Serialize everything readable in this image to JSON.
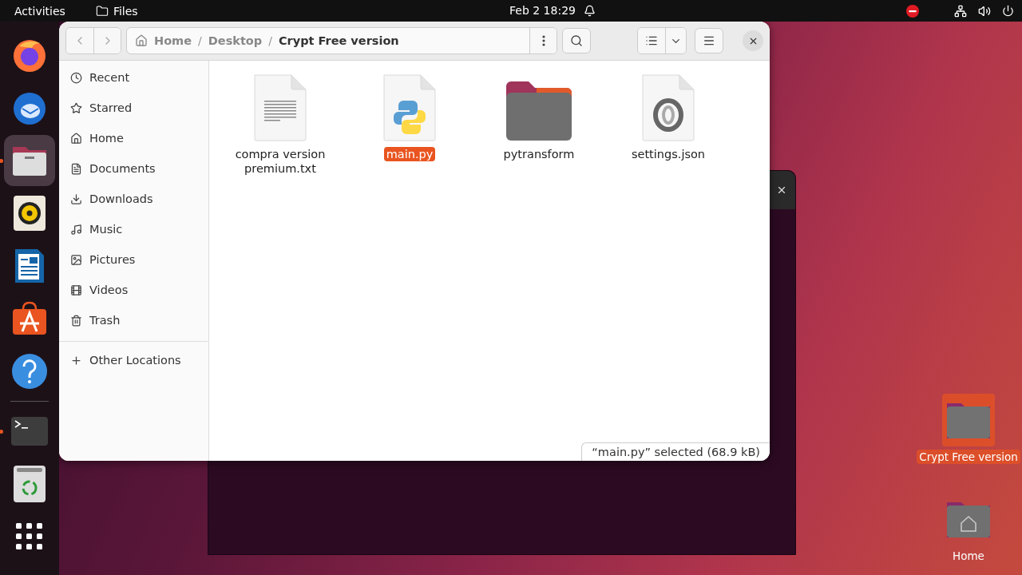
{
  "top_bar": {
    "activities": "Activities",
    "app_name": "Files",
    "datetime": "Feb 2  18:29"
  },
  "dock": {
    "items": [
      {
        "kind": "firefox",
        "running": false,
        "selected": false
      },
      {
        "kind": "thunderbird",
        "running": false,
        "selected": false
      },
      {
        "kind": "files",
        "running": true,
        "selected": true
      },
      {
        "kind": "rhythmbox",
        "running": false,
        "selected": false
      },
      {
        "kind": "writer",
        "running": false,
        "selected": false
      },
      {
        "kind": "software",
        "running": false,
        "selected": false
      },
      {
        "kind": "help",
        "running": false,
        "selected": false
      }
    ],
    "lower_items": [
      {
        "kind": "terminal",
        "running": true,
        "selected": false
      },
      {
        "kind": "trash",
        "running": false,
        "selected": false
      },
      {
        "kind": "apps",
        "running": false,
        "selected": false
      }
    ]
  },
  "window": {
    "breadcrumb": [
      {
        "label": "Home",
        "current": false
      },
      {
        "label": "Desktop",
        "current": false,
        "separator": "/"
      },
      {
        "label": "Crypt Free version",
        "current": true,
        "separator": "/"
      }
    ],
    "sidebar": {
      "items": [
        {
          "label": "Recent",
          "kind": "recent"
        },
        {
          "label": "Starred",
          "kind": "starred"
        },
        {
          "label": "Home",
          "kind": "home"
        },
        {
          "label": "Documents",
          "kind": "documents"
        },
        {
          "label": "Downloads",
          "kind": "downloads"
        },
        {
          "label": "Music",
          "kind": "music"
        },
        {
          "label": "Pictures",
          "kind": "pictures"
        },
        {
          "label": "Videos",
          "kind": "videos"
        },
        {
          "label": "Trash",
          "kind": "trash"
        }
      ],
      "other_locations": "Other Locations"
    },
    "files": [
      {
        "name": "compra version premium.txt",
        "kind": "text",
        "selected": false
      },
      {
        "name": "main.py",
        "kind": "python",
        "selected": true
      },
      {
        "name": "pytransform",
        "kind": "folder",
        "selected": false
      },
      {
        "name": "settings.json",
        "kind": "json",
        "selected": false
      }
    ],
    "status": "“main.py” selected (68.9 kB)"
  },
  "desktop_icons": [
    {
      "label": "Crypt Free version",
      "kind": "folder",
      "selected": true
    },
    {
      "label": "Home",
      "kind": "home",
      "selected": false
    }
  ]
}
